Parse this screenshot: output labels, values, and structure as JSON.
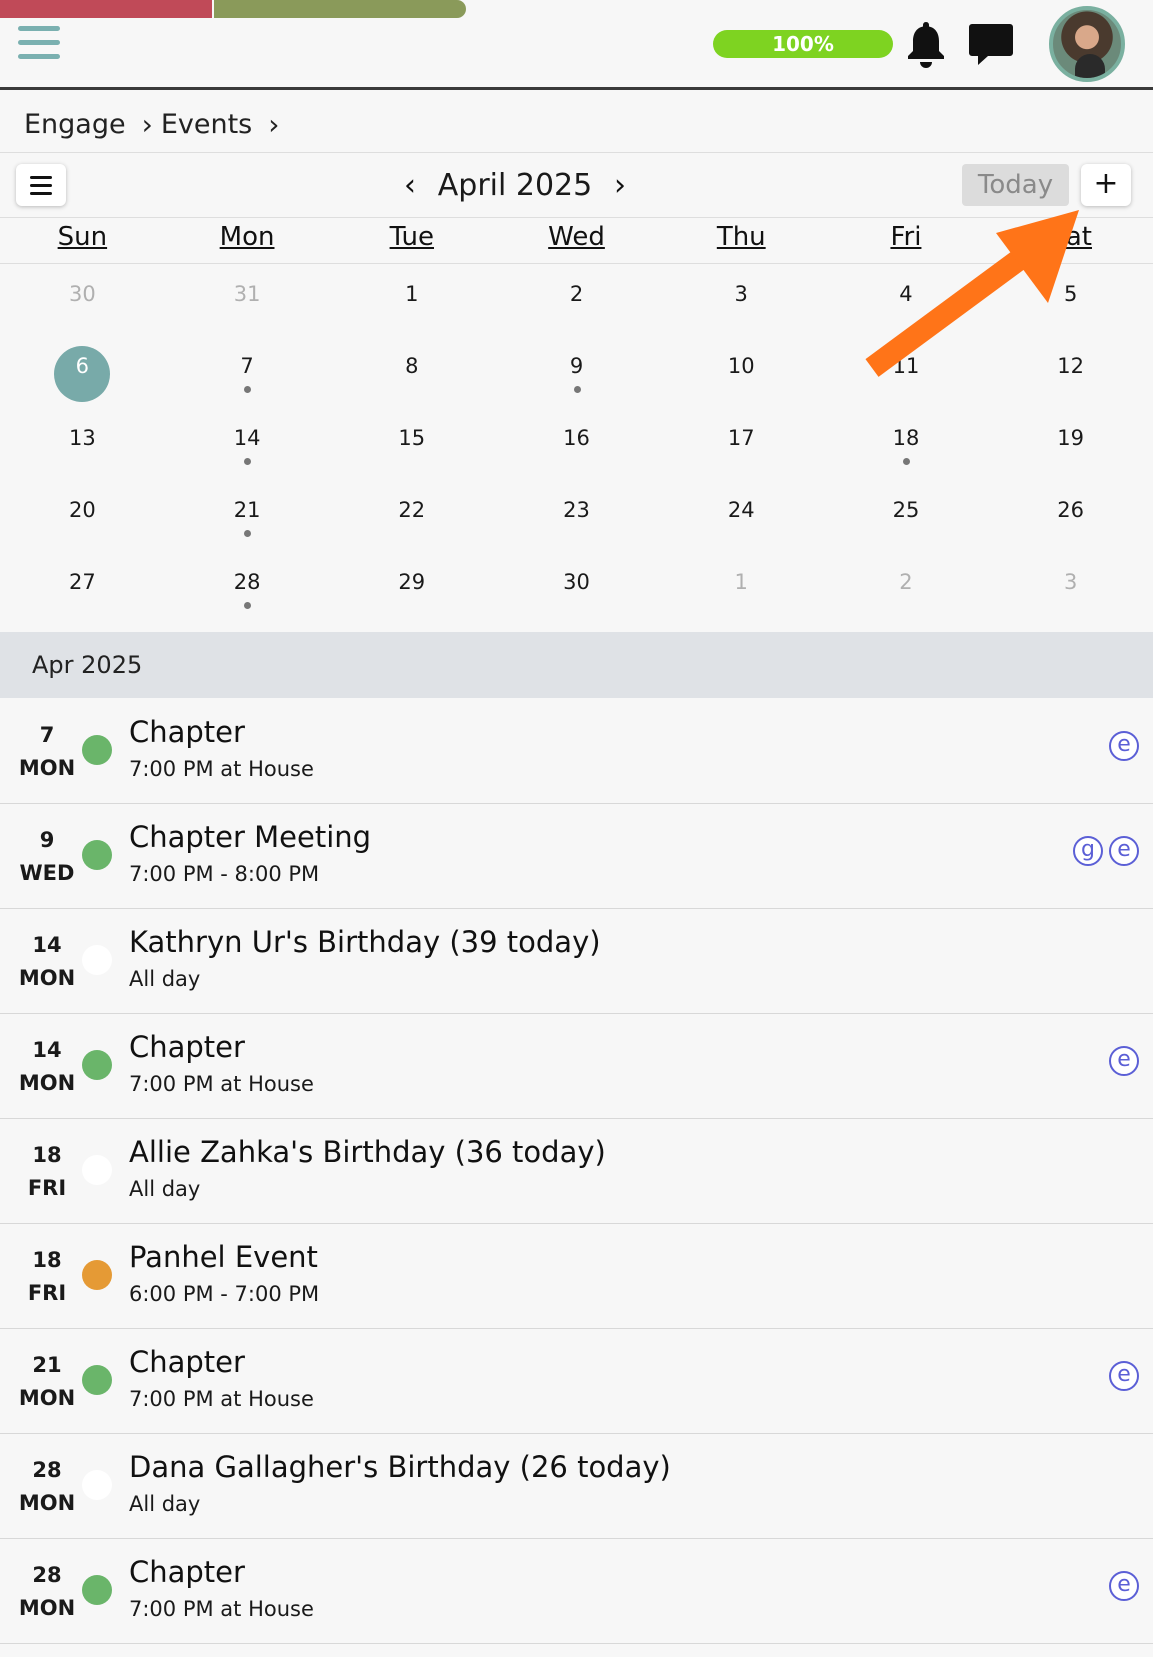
{
  "header": {
    "progress_percent": "100%"
  },
  "breadcrumb": [
    "Engage",
    "Events"
  ],
  "calendar": {
    "month_label": "April 2025",
    "today_label": "Today",
    "add_label": "+",
    "weekdays": [
      "Sun",
      "Mon",
      "Tue",
      "Wed",
      "Thu",
      "Fri",
      "Sat"
    ],
    "weeks": [
      [
        {
          "d": "30",
          "o": true
        },
        {
          "d": "31",
          "o": true
        },
        {
          "d": "1"
        },
        {
          "d": "2"
        },
        {
          "d": "3"
        },
        {
          "d": "4"
        },
        {
          "d": "5"
        }
      ],
      [
        {
          "d": "6",
          "sel": true
        },
        {
          "d": "7",
          "dot": true
        },
        {
          "d": "8"
        },
        {
          "d": "9",
          "dot": true
        },
        {
          "d": "10"
        },
        {
          "d": "11"
        },
        {
          "d": "12"
        }
      ],
      [
        {
          "d": "13"
        },
        {
          "d": "14",
          "dot": true
        },
        {
          "d": "15"
        },
        {
          "d": "16"
        },
        {
          "d": "17"
        },
        {
          "d": "18",
          "dot": true
        },
        {
          "d": "19"
        }
      ],
      [
        {
          "d": "20"
        },
        {
          "d": "21",
          "dot": true
        },
        {
          "d": "22"
        },
        {
          "d": "23"
        },
        {
          "d": "24"
        },
        {
          "d": "25"
        },
        {
          "d": "26"
        }
      ],
      [
        {
          "d": "27"
        },
        {
          "d": "28",
          "dot": true
        },
        {
          "d": "29"
        },
        {
          "d": "30"
        },
        {
          "d": "1",
          "o": true
        },
        {
          "d": "2",
          "o": true
        },
        {
          "d": "3",
          "o": true
        }
      ]
    ]
  },
  "month_band": "Apr 2025",
  "events": [
    {
      "day": "7",
      "dow": "MON",
      "color": "#6ab56a",
      "title": "Chapter",
      "sub": "7:00 PM at House",
      "badges": [
        "e"
      ]
    },
    {
      "day": "9",
      "dow": "WED",
      "color": "#6ab56a",
      "title": "Chapter Meeting",
      "sub": "7:00 PM - 8:00 PM",
      "badges": [
        "g",
        "e"
      ]
    },
    {
      "day": "14",
      "dow": "MON",
      "color": "#ffffff",
      "title": "Kathryn Ur's Birthday (39 today)",
      "sub": "All day",
      "badges": []
    },
    {
      "day": "14",
      "dow": "MON",
      "color": "#6ab56a",
      "title": "Chapter",
      "sub": "7:00 PM at House",
      "badges": [
        "e"
      ]
    },
    {
      "day": "18",
      "dow": "FRI",
      "color": "#ffffff",
      "title": "Allie Zahka's Birthday (36 today)",
      "sub": "All day",
      "badges": []
    },
    {
      "day": "18",
      "dow": "FRI",
      "color": "#e59a35",
      "title": "Panhel Event",
      "sub": "6:00 PM - 7:00 PM",
      "badges": []
    },
    {
      "day": "21",
      "dow": "MON",
      "color": "#6ab56a",
      "title": "Chapter",
      "sub": "7:00 PM at House",
      "badges": [
        "e"
      ]
    },
    {
      "day": "28",
      "dow": "MON",
      "color": "#ffffff",
      "title": "Dana Gallagher's Birthday (26 today)",
      "sub": "All day",
      "badges": []
    },
    {
      "day": "28",
      "dow": "MON",
      "color": "#6ab56a",
      "title": "Chapter",
      "sub": "7:00 PM at House",
      "badges": [
        "e"
      ]
    }
  ]
}
